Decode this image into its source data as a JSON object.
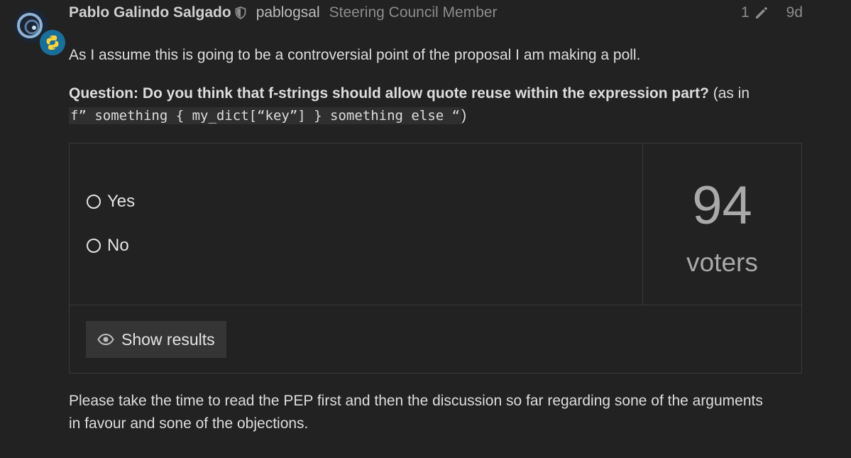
{
  "post": {
    "author": {
      "name": "Pablo Galindo Salgado",
      "handle": "pablogsal",
      "title": "Steering Council Member",
      "moderator_icon": "shield-icon",
      "flair_icon": "python-icon"
    },
    "meta": {
      "edit_count": "1",
      "edit_icon": "pencil-icon",
      "age": "9d"
    },
    "body": {
      "intro": "As I assume this is going to be a controversial point of the proposal I am making a poll.",
      "question_bold": "Question: Do you think that f-strings should allow quote reuse within the expression part?",
      "question_suffix": " (as in",
      "code_example": "f” something { my_dict[“key”] } something else “",
      "question_close": ")",
      "footer": "Please take the time to read the PEP first and then the discussion so far regarding sone of the arguments in favour and sone of the objections."
    },
    "poll": {
      "options": [
        {
          "label": "Yes",
          "selected": false
        },
        {
          "label": "No",
          "selected": false
        }
      ],
      "voters_count": "94",
      "voters_label": "voters",
      "show_results_label": "Show results",
      "show_results_icon": "eye-icon"
    }
  },
  "colors": {
    "background": "#222222",
    "text": "#dddddd",
    "muted": "#8c8c8c",
    "border": "#3a3a3a",
    "button_bg": "#353535",
    "flair_bg": "#1a6f9a"
  }
}
